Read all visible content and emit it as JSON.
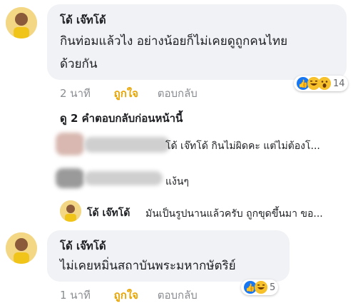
{
  "comment1": {
    "author": "โด้ เจ๊ทโด้",
    "line1": "กินท่อมแล้วไง อย่างน้อยก็ไม่เคยดูถูกคนไทย",
    "line2": "ด้วยกัน",
    "time": "2 นาที",
    "like": "ถูกใจ",
    "reply": "ตอบกลับ",
    "reaction_count": "14"
  },
  "prev_replies": "ดู 2 คำตอบกลับก่อนหน้านี้",
  "reply1": {
    "text": "โด้ เจ๊ทโด้ กินไม่ผิดคะ แต่ไม่ต้องโ..."
  },
  "reply2": {
    "text": "แง้นๆ"
  },
  "reply3": {
    "author": "โด้ เจ๊ทโด้",
    "text": "มันเป็นรูปนานแล้วครับ ถูกขุดขึ้นมา ขอ..."
  },
  "comment2": {
    "author": "โด้ เจ๊ทโด้",
    "text": "ไม่เคยหมิ่นสถาบันพระมหากษัตริย์",
    "time": "1 นาที",
    "like": "ถูกใจ",
    "reply": "ตอบกลับ",
    "reaction_count": "5"
  },
  "colors": {
    "bubble": "#f0f2f5",
    "like": "#e8a400",
    "meta": "#8a8d91",
    "like_blue": "#1877f2",
    "haha_yellow": "#f7c12c"
  }
}
